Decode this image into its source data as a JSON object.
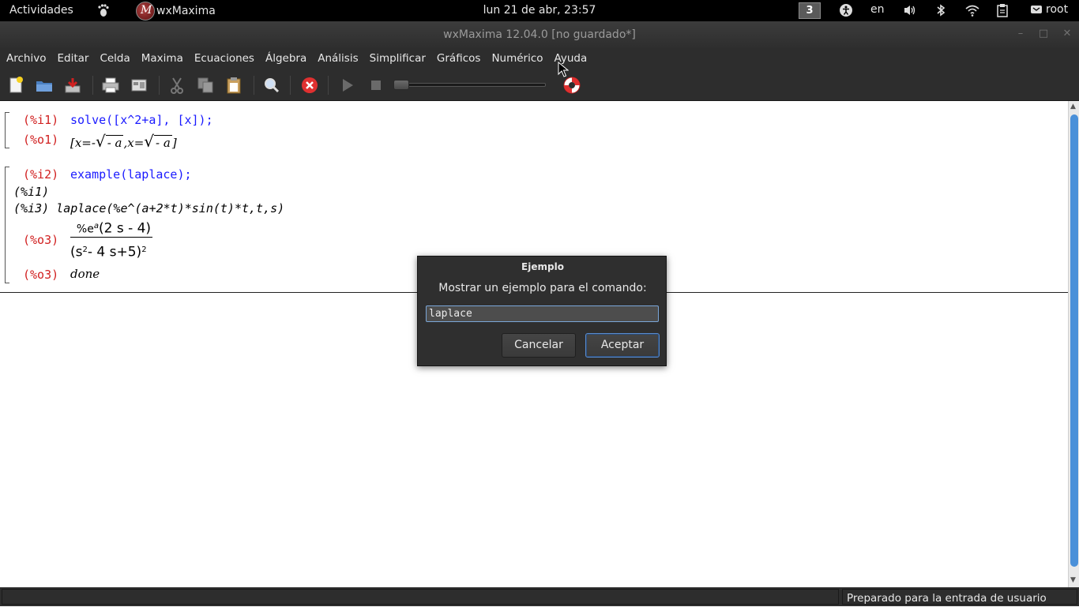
{
  "topbar": {
    "activities": "Actividades",
    "app_name": "wxMaxima",
    "clock": "lun 21 de abr, 23:57",
    "workspace": "3",
    "language": "en",
    "user": "root"
  },
  "window": {
    "title": "wxMaxima 12.04.0 [no guardado*]"
  },
  "menubar": {
    "items": [
      "Archivo",
      "Editar",
      "Celda",
      "Maxima",
      "Ecuaciones",
      "Álgebra",
      "Análisis",
      "Simplificar",
      "Gráficos",
      "Numérico",
      "Ayuda"
    ]
  },
  "worksheet": {
    "cell1": {
      "in_label": "(%i1)",
      "in_text": "solve([x^2+a], [x]);",
      "out_label": "(%o1)",
      "out_a": "[x=-",
      "out_b": "- a",
      "out_c": ",x=",
      "out_d": "- a",
      "out_e": "]"
    },
    "cell2": {
      "in_label": "(%i2)",
      "in_text": "example(laplace);",
      "line1": "(%i1)",
      "line2": "(%i3) laplace(%e^(a+2*t)*sin(t)*t,t,s)",
      "out3_label": "(%o3)",
      "num_base": "%e",
      "num_exp": "a",
      "num_rest": "(2 s - 4)",
      "den_a": "(s",
      "den_exp": "2",
      "den_b": "- 4 s+5)",
      "den_pow": "2",
      "out3b_label": "(%o3)",
      "out3b_text": "done"
    }
  },
  "dialog": {
    "title": "Ejemplo",
    "message": "Mostrar un ejemplo para el comando:",
    "input_value": "laplace",
    "cancel_label": "Cancelar",
    "ok_label": "Aceptar"
  },
  "statusbar": {
    "message": "Preparado para la entrada de usuario"
  },
  "colors": {
    "input_text": "#1a1aff",
    "label_text": "#d12020",
    "dialog_focus": "#5b8ccc"
  }
}
